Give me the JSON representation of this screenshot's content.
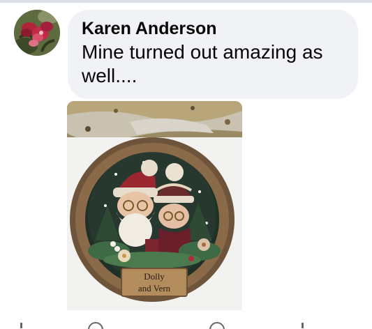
{
  "comment": {
    "author": "Karen Anderson",
    "text": "Mine turned out amazing as well....",
    "avatar_icon": "flower-avatar"
  },
  "attachment": {
    "image_icon": "christmas-sign-photo",
    "sign_text_line1": "Dolly",
    "sign_text_line2": "and Vern"
  },
  "colors": {
    "bubble": "#f0f2f5",
    "text": "#050505",
    "divider": "#dcdfe3",
    "icon": "#65676b"
  }
}
